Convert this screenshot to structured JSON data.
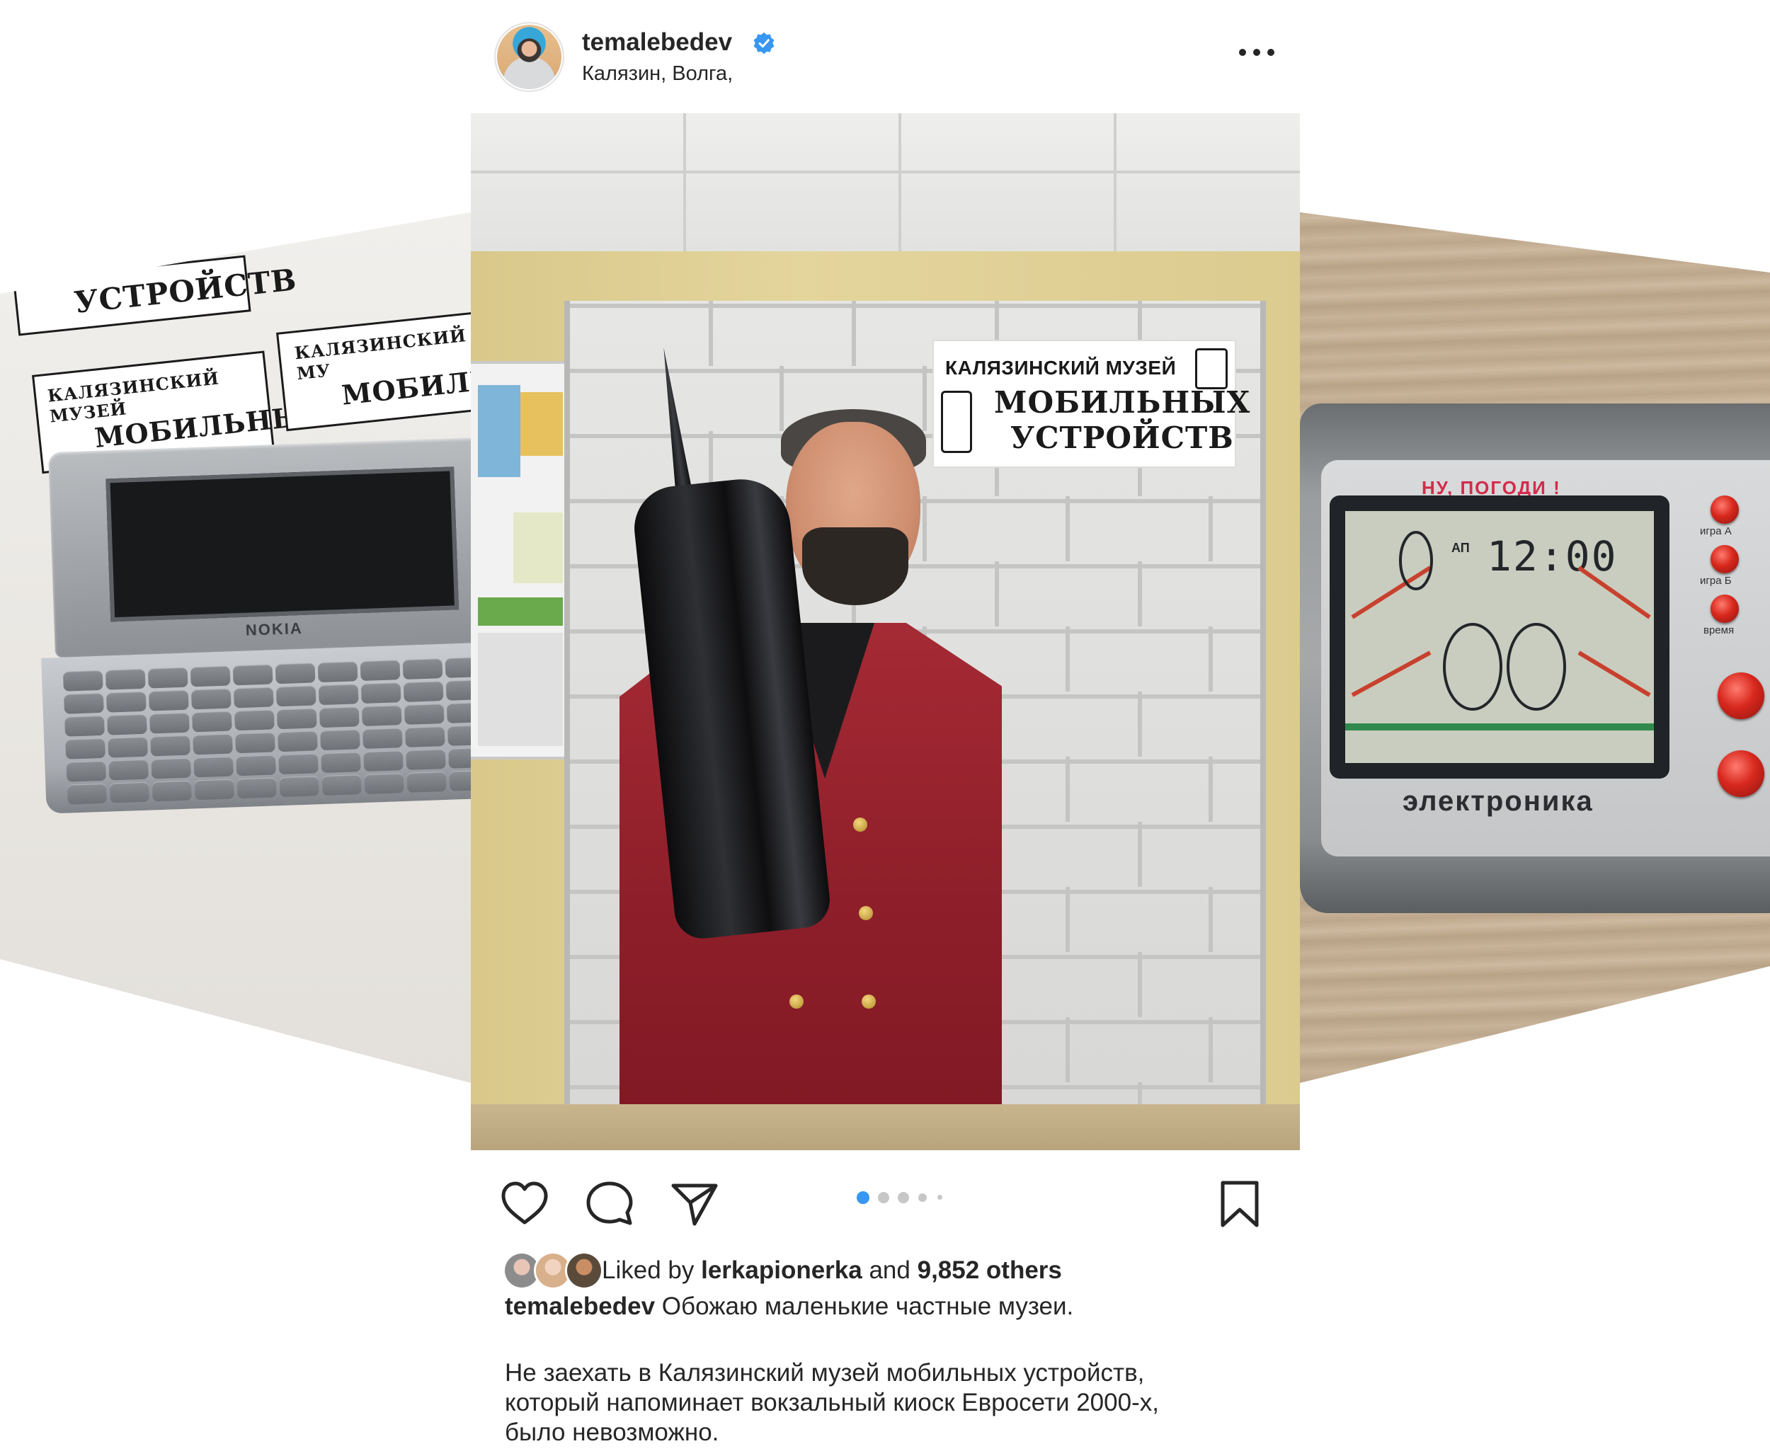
{
  "post": {
    "username": "temalebedev",
    "verified": true,
    "location": "Калязин, Волга,",
    "more_label": "•••",
    "image": {
      "sign_line1": "КАЛЯЗИНСКИЙ МУЗЕЙ",
      "sign_line2": "МОБИЛЬНЫХ",
      "sign_line3": "УСТРОЙСТВ"
    },
    "carousel": {
      "total": 5,
      "active_index": 0
    },
    "likes": {
      "prefix": "Liked by",
      "user": "lerkapionerka",
      "connector": "and",
      "others": "9,852 others"
    },
    "caption": {
      "author": "temalebedev",
      "first_line": "Обожаю маленькие частные музеи.",
      "paragraph": [
        "Не заехать в Калязинский музей мобильных устройств,",
        "который напоминает вокзальный киоск Евросети 2000-х,",
        "было невозможно."
      ]
    }
  },
  "side_left": {
    "sign_top": "УСТРОЙСТВ",
    "sign_a_line1": "КАЛЯЗИНСКИЙ МУЗЕЙ",
    "sign_a_line2": "МОБИЛЬНЫХ",
    "sign_b_line1": "КАЛЯЗИНСКИЙ МУ",
    "sign_b_line2": "МОБИЛЬ",
    "device_brand": "NOKIA"
  },
  "side_right": {
    "game_title": "НУ, ПОГОДИ !",
    "lcd_time": "12:00",
    "lcd_am": "АП",
    "brand": "электроника",
    "button_labels": [
      "игра А",
      "игра Б",
      "время"
    ]
  },
  "colors": {
    "accent_blue": "#3897f0",
    "text": "#262626",
    "dot_inactive": "#c7c7c7",
    "jacket": "#9b2531"
  }
}
